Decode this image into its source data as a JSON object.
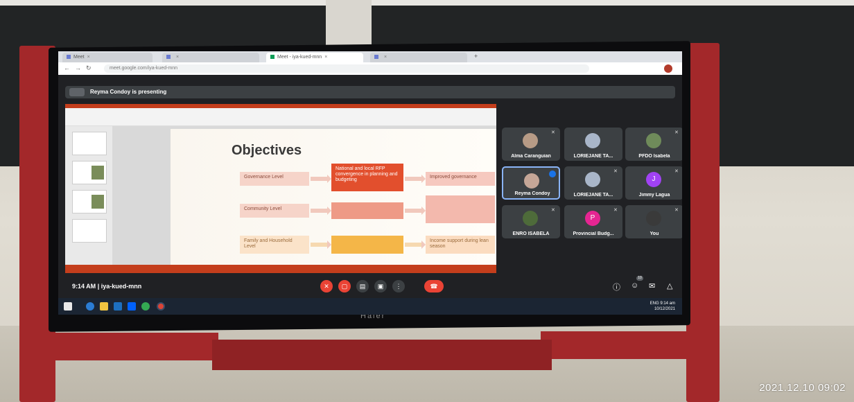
{
  "browser": {
    "tabs": [
      {
        "label": "Meet",
        "active": false
      },
      {
        "label": "",
        "active": false
      },
      {
        "label": "Meet - iya-kued-mnn",
        "active": true
      },
      {
        "label": "",
        "active": false
      }
    ],
    "new_tab_icon": "+",
    "address": "meet.google.com/iya-kued-mnn"
  },
  "meet": {
    "presenting_banner": "Reyma Condoy is presenting",
    "meeting_time": "9:14 AM",
    "meeting_code": "iya-kued-mnn",
    "participants": [
      {
        "name": "Alma Caranguian",
        "avatar_color": "#b79b86",
        "muted": true,
        "active": false
      },
      {
        "name": "LORIEJANE TA...",
        "avatar_color": "#a9b6c9",
        "muted": false,
        "active": false
      },
      {
        "name": "PFDO Isabela",
        "avatar_color": "#6f8b5a",
        "muted": true,
        "active": false
      },
      {
        "name": "Reyma Condoy",
        "avatar_color": "#c5a697",
        "muted": false,
        "active": true
      },
      {
        "name": "LORIEJANE TA...",
        "avatar_color": "#a9b6c9",
        "muted": true,
        "active": false
      },
      {
        "name": "Jimmy Lagua",
        "avatar_letter": "J",
        "avatar_color": "#a142f4",
        "muted": true,
        "active": false
      },
      {
        "name": "ENRO ISABELA",
        "avatar_color": "#4e6b3a",
        "muted": true,
        "active": false
      },
      {
        "name": "Provincial Budg...",
        "avatar_letter": "P",
        "avatar_color": "#e52592",
        "muted": true,
        "active": false
      },
      {
        "name": "You",
        "avatar_color": "#3a3a3a",
        "muted": true,
        "active": false
      }
    ],
    "participant_count": "10"
  },
  "slide": {
    "title": "Objectives",
    "rows": [
      {
        "left": "Governance Level",
        "middle": "National and local RFP convergence in planning and budgeting",
        "right": "Improved governance"
      },
      {
        "left": "Community Level",
        "middle": "",
        "right": ""
      },
      {
        "left": "Family and Household Level",
        "middle": "",
        "right": "Income support during lean season"
      }
    ]
  },
  "taskbar": {
    "time": "9:14 am",
    "date": "10/12/2021",
    "lang": "ENG"
  },
  "monitor": {
    "brand": "Haier"
  },
  "photo": {
    "timestamp": "2021.12.10 09:02"
  },
  "colors": {
    "meet_bg": "#202124",
    "tile_bg": "#3c4043",
    "accent_red": "#ea4335",
    "stand_red": "#a3282a",
    "ppt_red": "#c43e1c"
  }
}
